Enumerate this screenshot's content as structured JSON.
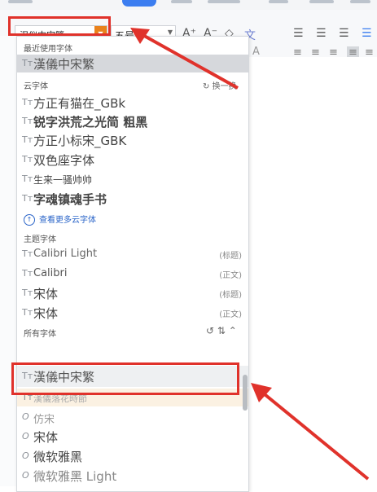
{
  "toolbar": {
    "font_value": "汉仪中宋繁",
    "size_value": "五号",
    "grow_font_icon": "A⁺",
    "shrink_font_icon": "A⁻",
    "clear_format_icon": "◇",
    "phonetic_icon": "文",
    "bullet_list_icon": "☰",
    "number_list_icon": "☰",
    "indent_icon": "☰"
  },
  "dropdown": {
    "recent_header": "最近使用字体",
    "recent_items": [
      {
        "name": "漢儀中宋繁",
        "icon": "font-tt-icon"
      }
    ],
    "cloud_header": "云字体",
    "cloud_refresh": "换一换",
    "cloud_items": [
      {
        "name": "方正有猫在_GBk"
      },
      {
        "name": "锐字洪荒之光简 粗黑"
      },
      {
        "name": "方正小标宋_GBK"
      },
      {
        "name": "双色座字体"
      },
      {
        "name": "生来一骚帅帅"
      },
      {
        "name": "字魂镇魂手书"
      }
    ],
    "more_cloud_link": "查看更多云字体",
    "theme_header": "主题字体",
    "theme_items": [
      {
        "name": "Calibri Light",
        "tag": "(标题)"
      },
      {
        "name": "Calibri",
        "tag": "(正文)"
      },
      {
        "name": "宋体",
        "tag": "(标题)"
      },
      {
        "name": "宋体",
        "tag": "(正文)"
      }
    ],
    "all_header": "所有字体",
    "all_items": [
      {
        "name": "漢儀中宋繁",
        "state": "selected"
      },
      {
        "name": "漢儀落花時節",
        "state": "hover"
      },
      {
        "name": "仿宋",
        "icon": "O"
      },
      {
        "name": "宋体",
        "icon": "O"
      },
      {
        "name": "微软雅黑",
        "icon": "O"
      },
      {
        "name": "微软雅黑 Light",
        "icon": "O"
      }
    ]
  },
  "colors": {
    "highlight_red": "#e0322b",
    "combo_arrow_orange": "#e9821c",
    "link_blue": "#2a64c8"
  }
}
